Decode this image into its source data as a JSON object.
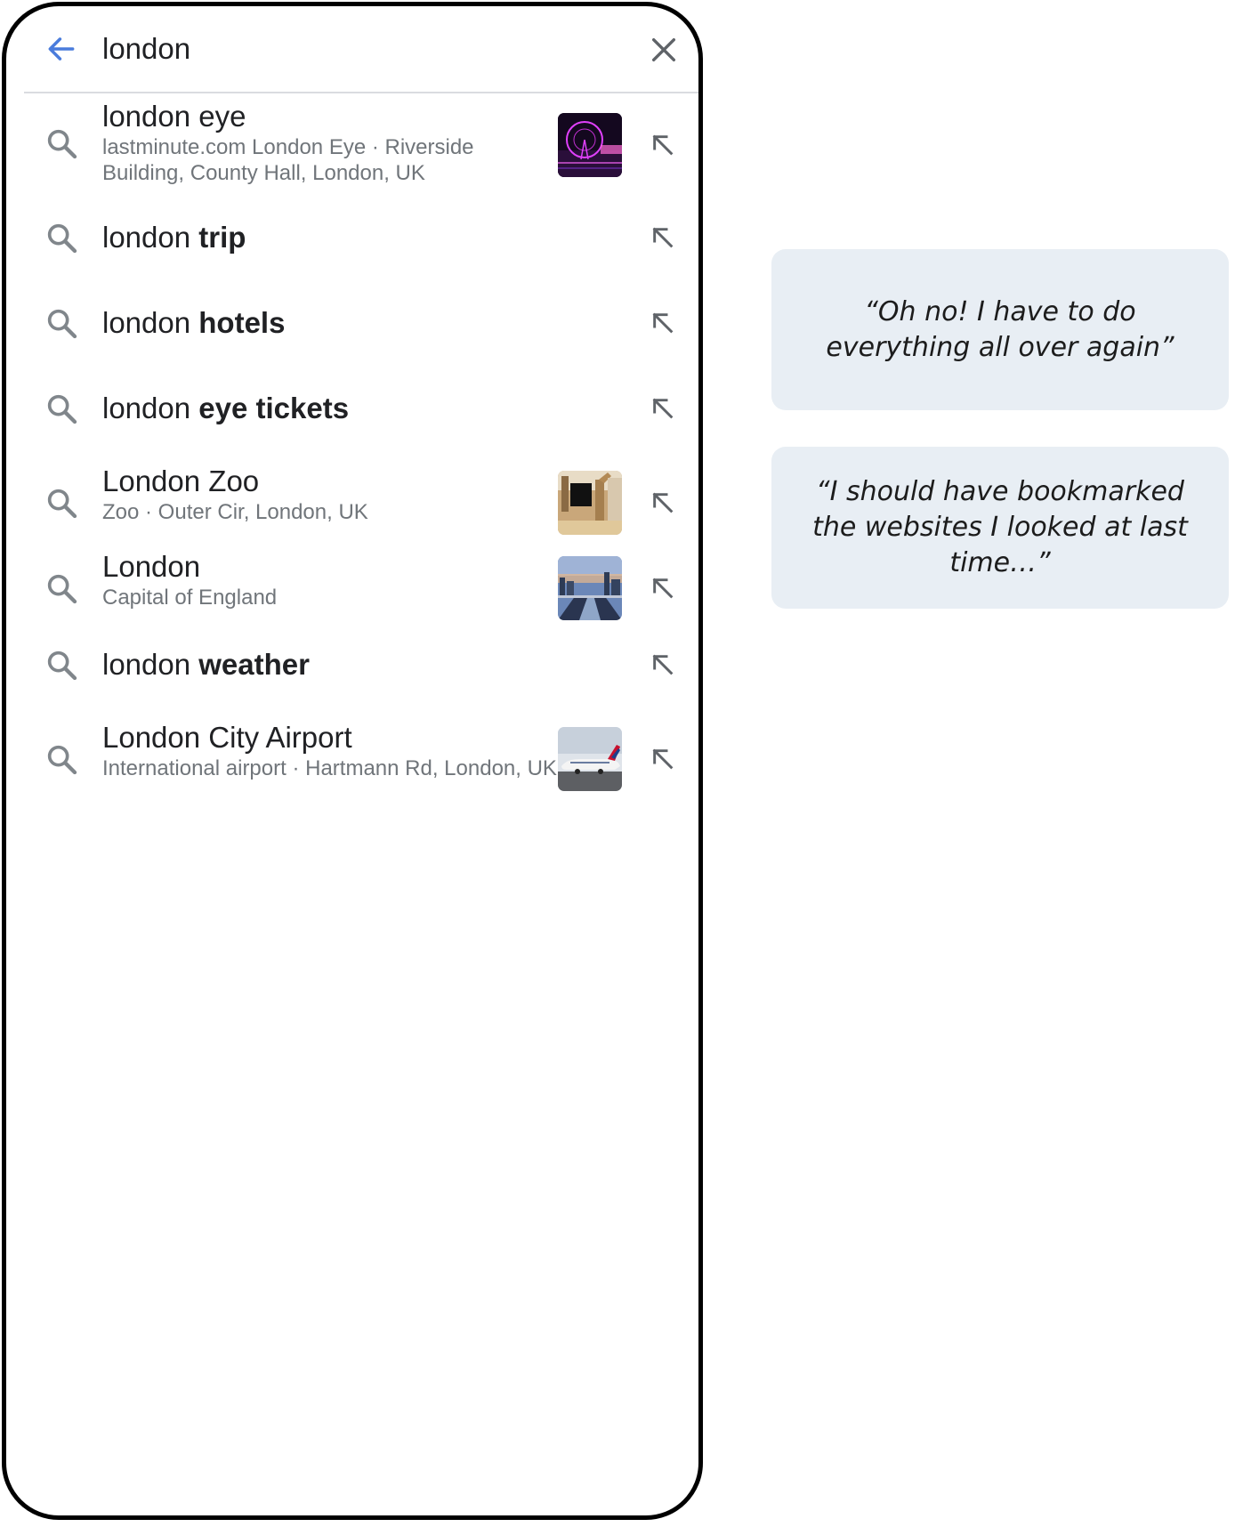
{
  "search": {
    "query": "london"
  },
  "results": [
    {
      "prefix": "london",
      "suffix": " eye",
      "suffix_bold": false,
      "subtitle": "lastminute.com London Eye · Riverside Building, County Hall, London, UK",
      "thumbnail": "london-eye-night"
    },
    {
      "prefix": "london ",
      "suffix": "trip",
      "suffix_bold": true,
      "subtitle": "",
      "thumbnail": ""
    },
    {
      "prefix": "london ",
      "suffix": "hotels",
      "suffix_bold": true,
      "subtitle": "",
      "thumbnail": ""
    },
    {
      "prefix": "london ",
      "suffix": "eye tickets",
      "suffix_bold": true,
      "subtitle": "",
      "thumbnail": ""
    },
    {
      "prefix": "London Zoo",
      "suffix": "",
      "suffix_bold": false,
      "subtitle": "Zoo · Outer Cir, London, UK",
      "thumbnail": "zoo-giraffes"
    },
    {
      "prefix": "London",
      "suffix": "",
      "suffix_bold": false,
      "subtitle": "Capital of England",
      "thumbnail": "london-skyline"
    },
    {
      "prefix": "london ",
      "suffix": "weather",
      "suffix_bold": true,
      "subtitle": "",
      "thumbnail": ""
    },
    {
      "prefix": "London City Airport",
      "suffix": "",
      "suffix_bold": false,
      "subtitle": "International airport · Hartmann Rd, London, UK",
      "thumbnail": "airplane"
    }
  ],
  "quotes": [
    "“Oh no! I have to do everything all over again”",
    "“I should have bookmarked the websites I looked at last time…”"
  ],
  "colors": {
    "accent": "#4a7cdc",
    "icon": "#80868b",
    "quote_bg": "#e8eef4"
  },
  "icons": {
    "back": "arrow-left-icon",
    "clear": "close-icon",
    "search": "search-icon",
    "fill": "arrow-up-left-icon"
  }
}
